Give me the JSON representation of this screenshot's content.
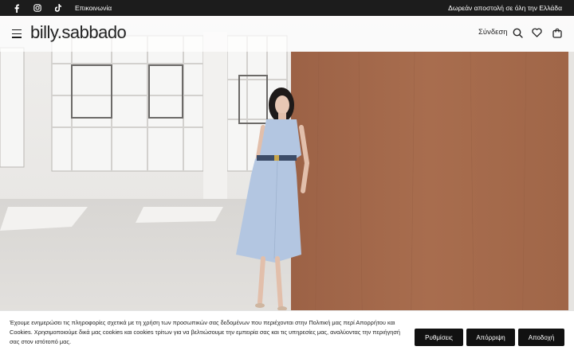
{
  "topbar": {
    "contact_label": "Επικοινωνία",
    "promo_text": "Δωρεάν αποστολή σε όλη την Ελλάδα",
    "social_icons": [
      "facebook-icon",
      "instagram-icon",
      "tiktok-icon"
    ]
  },
  "header": {
    "logo_text": "billy.sabbado",
    "login_label": "Σύνδεση",
    "icons": [
      "menu-icon",
      "search-icon",
      "heart-icon",
      "bag-icon"
    ]
  },
  "cookie": {
    "text": "Έχουμε ενημερώσει τις πληροφορίες σχετικά με τη χρήση των προσωπικών σας δεδομένων που περιέχονται στην Πολιτική μας περί Απορρήτου και Cookies. Χρησιμοποιούμε δικά μας cookies και cookies τρίτων για να βελτιώσουμε την εμπειρία σας και τις υπηρεσίες μας, αναλύοντας την περιήγησή σας στον ιστότοπό μας.",
    "settings_label": "Ρυθμίσεις",
    "reject_label": "Απόρριψη",
    "accept_label": "Αποδοχή"
  },
  "colors": {
    "topbar_bg": "#1c1c1c",
    "button_bg": "#111111",
    "wood": "#a46a4c",
    "dress": "#b3c6e1"
  }
}
